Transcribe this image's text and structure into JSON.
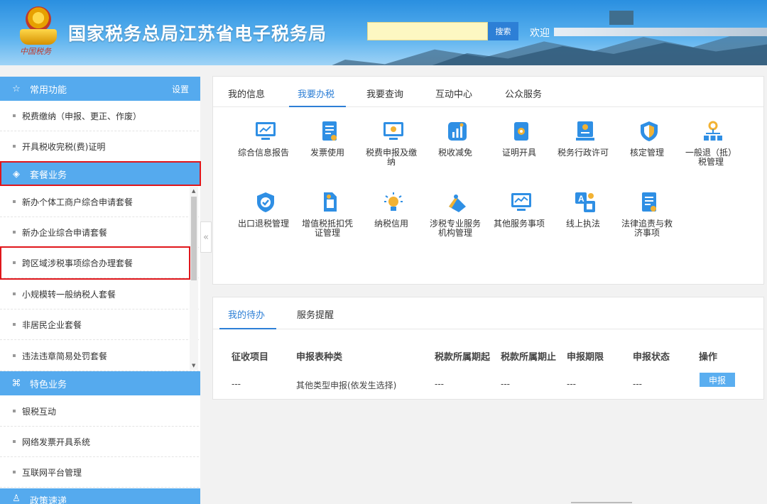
{
  "header": {
    "site_title": "国家税务总局江苏省电子税务局",
    "emblem_text": "中国税务",
    "search_placeholder": "",
    "search_button": "搜索",
    "welcome": "欢迎"
  },
  "sidebar": {
    "common": {
      "title": "常用功能",
      "settings": "设置",
      "items": [
        "税费缴纳（申报、更正、作废）",
        "开具税收完税(费)证明"
      ]
    },
    "packages": {
      "title": "套餐业务",
      "items": [
        "新办个体工商户综合申请套餐",
        "新办企业综合申请套餐",
        "跨区域涉税事项综合办理套餐",
        "小规模转一般纳税人套餐",
        "非居民企业套餐",
        "违法违章简易处罚套餐"
      ]
    },
    "featured": {
      "title": "特色业务",
      "items": [
        "银税互动",
        "网络发票开具系统",
        "互联网平台管理"
      ]
    },
    "policy": {
      "title": "政策速递"
    }
  },
  "service_panel": {
    "tabs": [
      "我的信息",
      "我要办税",
      "我要查询",
      "互动中心",
      "公众服务"
    ],
    "active_tab": "我要办税",
    "services_row1": [
      "综合信息报告",
      "发票使用",
      "税费申报及缴纳",
      "税收减免",
      "证明开具",
      "税务行政许可",
      "核定管理",
      "一般退（抵）税管理"
    ],
    "services_row2": [
      "出口退税管理",
      "增值税抵扣凭证管理",
      "纳税信用",
      "涉税专业服务机构管理",
      "其他服务事项",
      "线上执法",
      "法律追责与救济事项"
    ]
  },
  "todo_panel": {
    "tabs": [
      "我的待办",
      "服务提醒"
    ],
    "active_tab": "我的待办",
    "columns": [
      "征收项目",
      "申报表种类",
      "税款所属期起",
      "税款所属期止",
      "申报期限",
      "申报状态",
      "操作"
    ],
    "row": [
      "---",
      "其他类型申报(依发生选择)",
      "---",
      "---",
      "---",
      "---"
    ],
    "action_label": "申报"
  },
  "colors": {
    "accent": "#2d7fd6",
    "sidebar_header": "#55aaee",
    "highlight_border": "#e0161b"
  }
}
